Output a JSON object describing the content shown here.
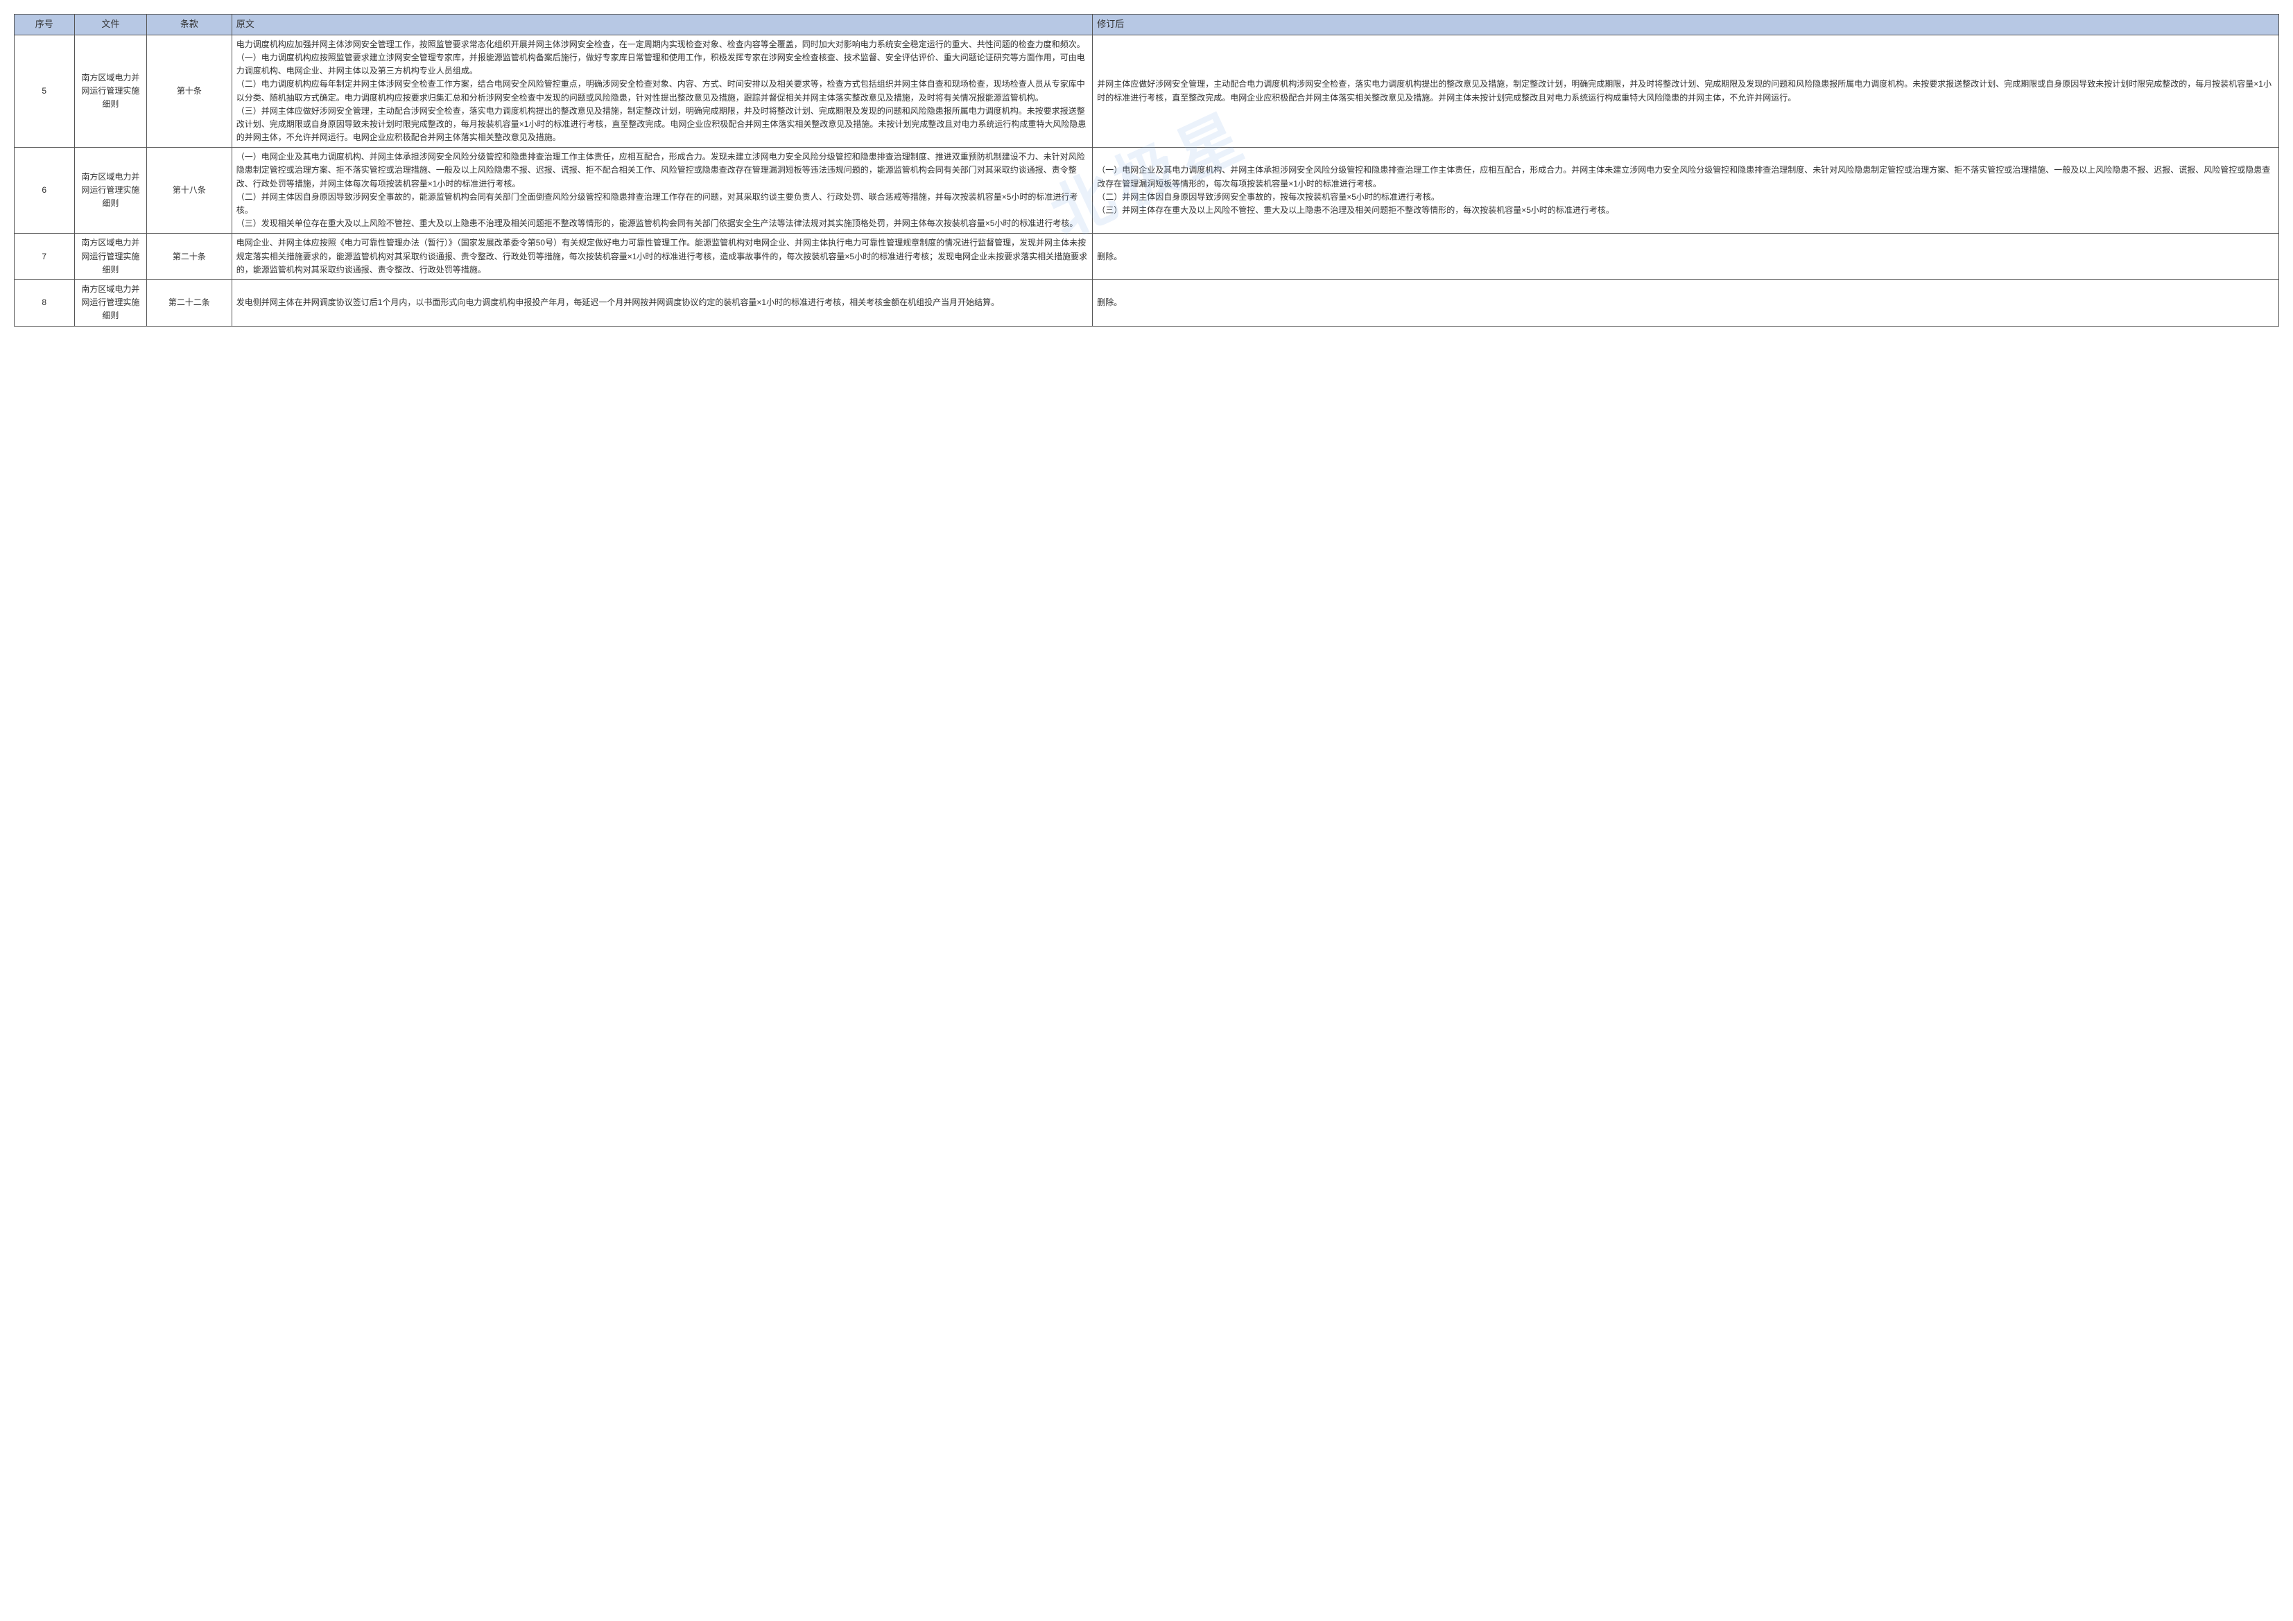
{
  "watermark": "北极星",
  "headers": {
    "idx": "序号",
    "file": "文件",
    "clause": "条款",
    "original": "原文",
    "revised": "修订后"
  },
  "rows": [
    {
      "idx": "5",
      "file": "南方区域电力并网运行管理实施细则",
      "clause": "第十条",
      "original": "电力调度机构应加强并网主体涉网安全管理工作，按照监管要求常态化组织开展并网主体涉网安全检查，在一定周期内实现检查对象、检查内容等全覆盖，同时加大对影响电力系统安全稳定运行的重大、共性问题的检查力度和频次。\n（一）电力调度机构应按照监管要求建立涉网安全管理专家库，并报能源监管机构备案后施行，做好专家库日常管理和使用工作，积极发挥专家在涉网安全检查核查、技术监督、安全评估评价、重大问题论证研究等方面作用，可由电力调度机构、电网企业、并网主体以及第三方机构专业人员组成。\n（二）电力调度机构应每年制定并网主体涉网安全检查工作方案，结合电网安全风险管控重点，明确涉网安全检查对象、内容、方式、时间安排以及相关要求等，检查方式包括组织并网主体自查和现场检查，现场检查人员从专家库中以分类、随机抽取方式确定。电力调度机构应按要求归集汇总和分析涉网安全检查中发现的问题或风险隐患，针对性提出整改意见及措施，跟踪并督促相关并网主体落实整改意见及措施，及时将有关情况报能源监管机构。\n（三）并网主体应做好涉网安全管理，主动配合涉网安全检查，落实电力调度机构提出的整改意见及措施，制定整改计划，明确完成期限，并及时将整改计划、完成期限及发现的问题和风险隐患报所属电力调度机构。未按要求报送整改计划、完成期限或自身原因导致未按计划时限完成整改的，每月按装机容量×1小时的标准进行考核，直至整改完成。电网企业应积极配合并网主体落实相关整改意见及措施。未按计划完成整改且对电力系统运行构成重特大风险隐患的并网主体，不允许并网运行。电网企业应积极配合并网主体落实相关整改意见及措施。",
      "revised": "并网主体应做好涉网安全管理，主动配合电力调度机构涉网安全检查，落实电力调度机构提出的整改意见及措施，制定整改计划，明确完成期限，并及时将整改计划、完成期限及发现的问题和风险隐患报所属电力调度机构。未按要求报送整改计划、完成期限或自身原因导致未按计划时限完成整改的，每月按装机容量×1小时的标准进行考核，直至整改完成。电网企业应积极配合并网主体落实相关整改意见及措施。并网主体未按计划完成整改且对电力系统运行构成重特大风险隐患的并网主体，不允许并网运行。"
    },
    {
      "idx": "6",
      "file": "南方区域电力并网运行管理实施细则",
      "clause": "第十八条",
      "original": "（一）电网企业及其电力调度机构、并网主体承担涉网安全风险分级管控和隐患排查治理工作主体责任，应相互配合，形成合力。发现未建立涉网电力安全风险分级管控和隐患排查治理制度、推进双重预防机制建设不力、未针对风险隐患制定管控或治理方案、拒不落实管控或治理措施、一般及以上风险隐患不报、迟报、谎报、拒不配合相关工作、风险管控或隐患查改存在管理漏洞短板等违法违规问题的，能源监管机构会同有关部门对其采取约谈通报、责令整改、行政处罚等措施，并网主体每次每项按装机容量×1小时的标准进行考核。\n（二）并网主体因自身原因导致涉网安全事故的，能源监管机构会同有关部门全面倒查风险分级管控和隐患排查治理工作存在的问题，对其采取约谈主要负责人、行政处罚、联合惩戒等措施，并每次按装机容量×5小时的标准进行考核。\n（三）发现相关单位存在重大及以上风险不管控、重大及以上隐患不治理及相关问题拒不整改等情形的，能源监管机构会同有关部门依据安全生产法等法律法规对其实施顶格处罚，并网主体每次按装机容量×5小时的标准进行考核。",
      "revised": "（一）电网企业及其电力调度机构、并网主体承担涉网安全风险分级管控和隐患排查治理工作主体责任，应相互配合，形成合力。并网主体未建立涉网电力安全风险分级管控和隐患排查治理制度、未针对风险隐患制定管控或治理方案、拒不落实管控或治理措施、一般及以上风险隐患不报、迟报、谎报、风险管控或隐患查改存在管理漏洞短板等情形的，每次每项按装机容量×1小时的标准进行考核。\n（二）并网主体因自身原因导致涉网安全事故的，按每次按装机容量×5小时的标准进行考核。\n（三）并网主体存在重大及以上风险不管控、重大及以上隐患不治理及相关问题拒不整改等情形的，每次按装机容量×5小时的标准进行考核。"
    },
    {
      "idx": "7",
      "file": "南方区域电力并网运行管理实施细则",
      "clause": "第二十条",
      "original": "电网企业、并网主体应按照《电力可靠性管理办法（暂行）》（国家发展改革委令第50号）有关规定做好电力可靠性管理工作。能源监管机构对电网企业、并网主体执行电力可靠性管理规章制度的情况进行监督管理，发现并网主体未按规定落实相关措施要求的，能源监管机构对其采取约谈通报、责令整改、行政处罚等措施，每次按装机容量×1小时的标准进行考核，造成事故事件的，每次按装机容量×5小时的标准进行考核；发现电网企业未按要求落实相关措施要求的，能源监管机构对其采取约谈通报、责令整改、行政处罚等措施。",
      "revised": "删除。"
    },
    {
      "idx": "8",
      "file": "南方区域电力并网运行管理实施细则",
      "clause": "第二十二条",
      "original": "发电侧并网主体在并网调度协议签订后1个月内，以书面形式向电力调度机构申报投产年月，每延迟一个月并网按并网调度协议约定的装机容量×1小时的标准进行考核，相关考核金额在机组投产当月开始结算。",
      "revised": "删除。"
    }
  ]
}
